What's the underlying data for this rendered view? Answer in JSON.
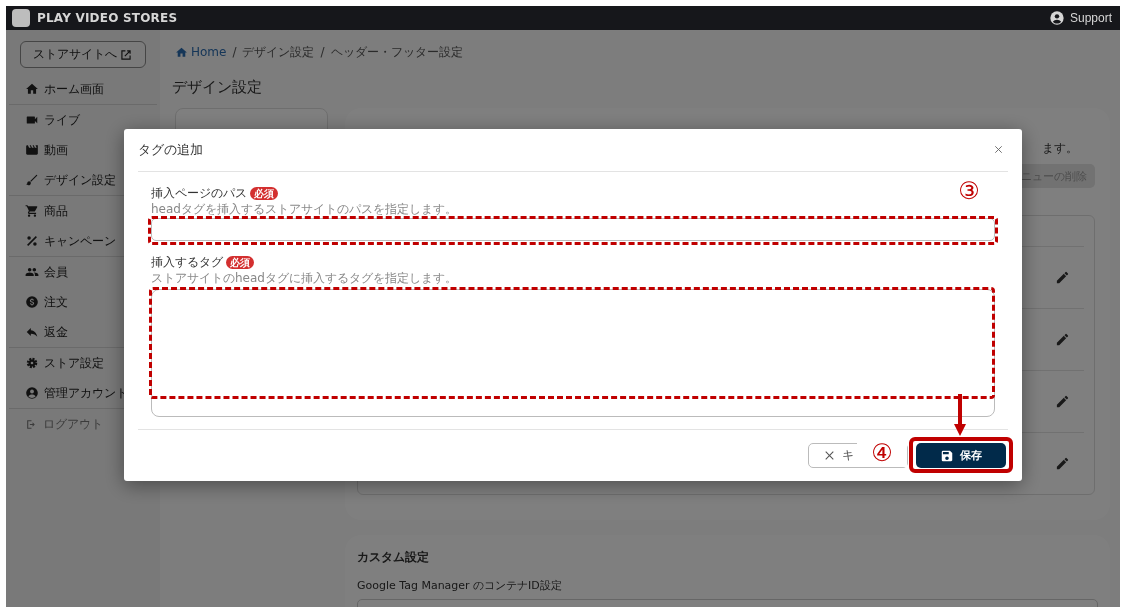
{
  "app_bar": {
    "brand": "PLAY VIDEO STORES",
    "support": "Support"
  },
  "sidebar": {
    "store_link": "ストアサイトへ",
    "groups": [
      [
        {
          "label": "ホーム画面"
        }
      ],
      [
        {
          "label": "ライブ"
        },
        {
          "label": "動画"
        },
        {
          "label": "デザイン設定"
        }
      ],
      [
        {
          "label": "商品"
        },
        {
          "label": "キャンペーン"
        }
      ],
      [
        {
          "label": "会員"
        },
        {
          "label": "注文"
        },
        {
          "label": "返金"
        }
      ],
      [
        {
          "label": "ストア設定"
        },
        {
          "label": "管理アカウント"
        }
      ],
      [
        {
          "label": "ログアウト"
        }
      ]
    ]
  },
  "breadcrumb": [
    "Home",
    "デザイン設定",
    "ヘッダー・フッター設定"
  ],
  "breadcrumb_separator": "/",
  "page_title": "デザイン設定",
  "header_panel": {
    "notice_fragment": "ます。",
    "delete_button": "ニューの削除"
  },
  "custom_settings": {
    "title": "カスタム設定",
    "gtm_label": "Google Tag Manager のコンテナID設定"
  },
  "dialog": {
    "title": "タグの追加",
    "fields": [
      {
        "kind": "input",
        "label": "挿入ページのパス",
        "badge": "必須",
        "help": "headタグを挿入するストアサイトのパスを指定します。"
      },
      {
        "kind": "textarea",
        "label": "挿入するタグ",
        "badge": "必須",
        "help": "ストアサイトのheadタグに挿入するタグを指定します。"
      }
    ],
    "cancel_button": "キ",
    "save_button": "保存"
  },
  "annotations": {
    "field_step": "③",
    "save_step": "④"
  }
}
